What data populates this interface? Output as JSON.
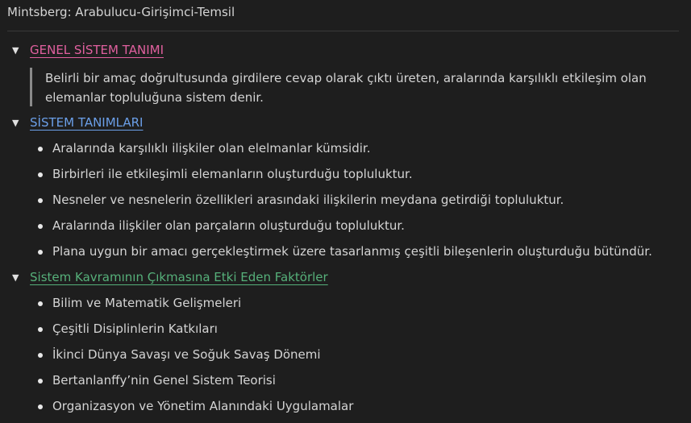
{
  "page": {
    "title": "Mintsberg: Arabulucu-Girişimci-Temsil"
  },
  "colors": {
    "background": "#1e1e1e",
    "text": "#d4d4d4",
    "heading_pink": "#e0609e",
    "heading_blue": "#6b9fe8",
    "heading_green": "#56b07a"
  },
  "sections": [
    {
      "heading": "GENEL SİSTEM TANIMI",
      "toggle_icon": "triangle-down-icon",
      "quote": "Belirli bir amaç doğrultusunda girdilere cevap olarak çıktı üreten, aralarında karşılıklı etkileşim olan elemanlar topluluğuna sistem denir."
    },
    {
      "heading": "SİSTEM TANIMLARI",
      "toggle_icon": "triangle-down-icon",
      "items": [
        "Aralarında karşılıklı ilişkiler olan elelmanlar kümsidir.",
        "Birbirleri ile etkileşimli elemanların oluşturduğu topluluktur.",
        "Nesneler ve nesnelerin özellikleri arasındaki ilişkilerin meydana getirdiği topluluktur.",
        "Aralarında ilişkiler olan parçaların oluşturduğu topluluktur.",
        "Plana uygun bir amacı gerçekleştirmek üzere tasarlanmış çeşitli bileşenlerin oluşturduğu bütündür."
      ]
    },
    {
      "heading": "Sistem Kavramının Çıkmasına Etki Eden Faktörler",
      "toggle_icon": "triangle-down-icon",
      "items": [
        "Bilim ve Matematik Gelişmeleri",
        "Çeşitli Disiplinlerin Katkıları",
        "İkinci Dünya Savaşı ve Soğuk Savaş Dönemi",
        "Bertanlanffy’nin Genel Sistem Teorisi",
        "Organizasyon ve Yönetim Alanındaki Uygulamalar"
      ]
    }
  ]
}
